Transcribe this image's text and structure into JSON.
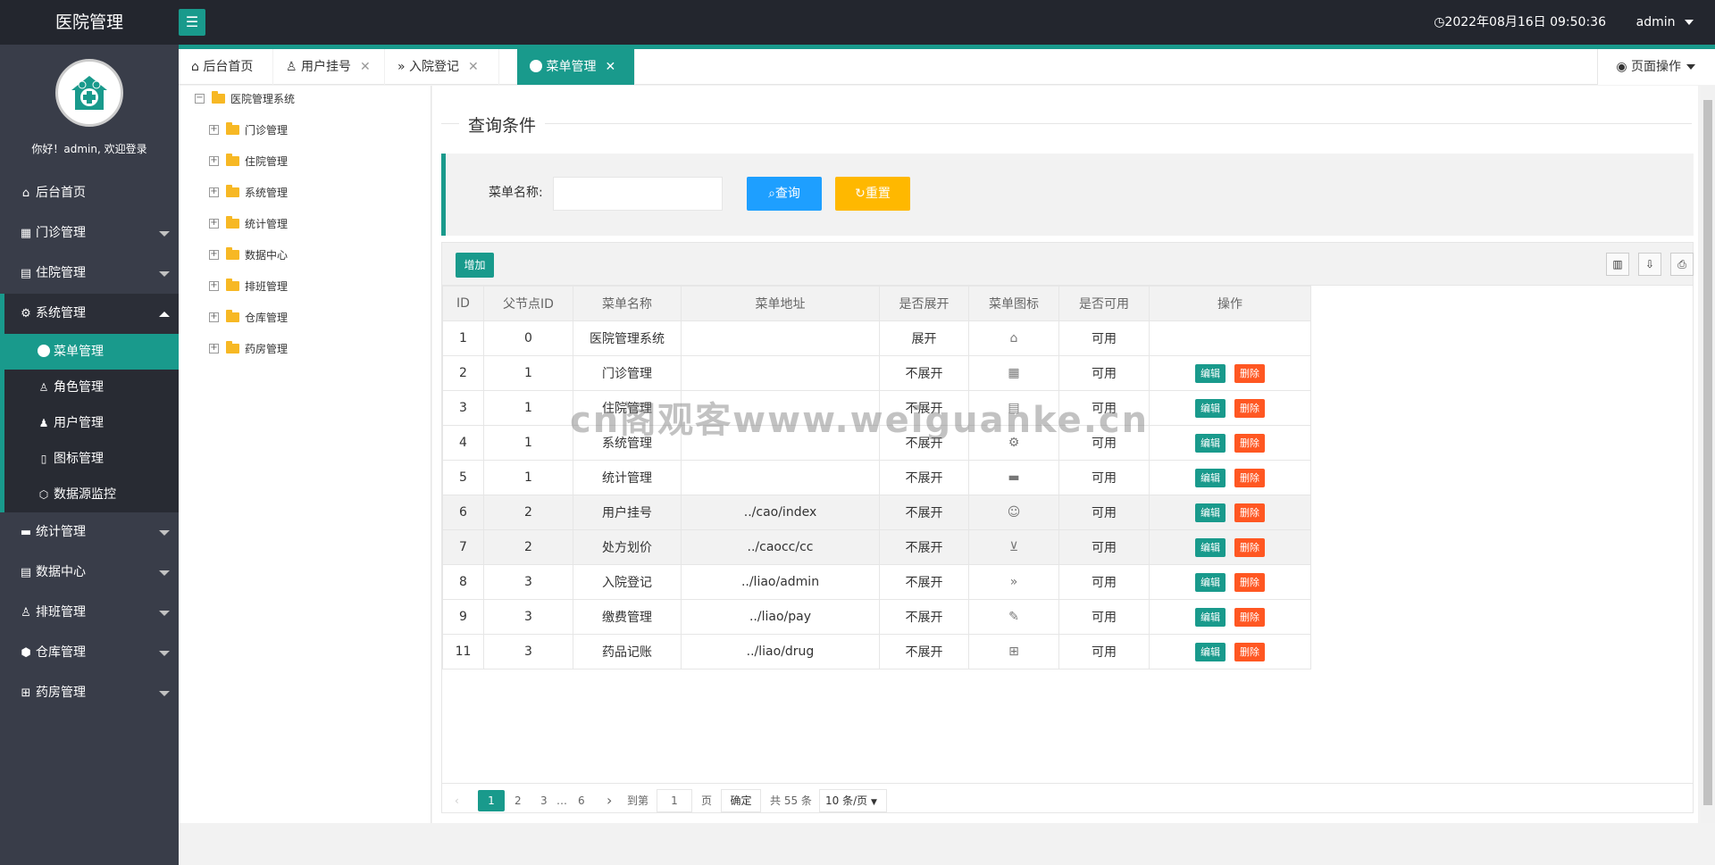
{
  "header": {
    "app_title": "医院管理",
    "datetime": "2022年08月16日 09:50:36",
    "user": "admin"
  },
  "sidebar": {
    "welcome": "你好！admin, 欢迎登录",
    "items": [
      {
        "label": "后台首页",
        "icon": "home-icon"
      },
      {
        "label": "门诊管理",
        "icon": "apps-icon"
      },
      {
        "label": "住院管理",
        "icon": "building-icon"
      },
      {
        "label": "系统管理",
        "icon": "gear-icon"
      },
      {
        "label": "统计管理",
        "icon": "chart-icon"
      },
      {
        "label": "数据中心",
        "icon": "document-icon"
      },
      {
        "label": "排班管理",
        "icon": "users-icon"
      },
      {
        "label": "仓库管理",
        "icon": "cubes-icon"
      },
      {
        "label": "药房管理",
        "icon": "book-icon"
      }
    ],
    "sub_items": [
      {
        "label": "菜单管理",
        "icon": "dot-icon"
      },
      {
        "label": "角色管理",
        "icon": "person-icon"
      },
      {
        "label": "用户管理",
        "icon": "user-icon"
      },
      {
        "label": "图标管理",
        "icon": "file-icon"
      },
      {
        "label": "数据源监控",
        "icon": "cube-icon"
      }
    ]
  },
  "tabs": [
    {
      "label": "后台首页"
    },
    {
      "label": "用户挂号"
    },
    {
      "label": "入院登记"
    },
    {
      "label": "菜单管理"
    }
  ],
  "page_op": "页面操作",
  "tree": {
    "root": "医院管理系统",
    "children": [
      "门诊管理",
      "住院管理",
      "系统管理",
      "统计管理",
      "数据中心",
      "排班管理",
      "仓库管理",
      "药房管理"
    ]
  },
  "query": {
    "legend": "查询条件",
    "menu_name_label": "菜单名称:",
    "menu_name_value": "",
    "query_btn": "查询",
    "reset_btn": "重置"
  },
  "toolbar": {
    "add_btn": "增加"
  },
  "table": {
    "columns": [
      "ID",
      "父节点ID",
      "菜单名称",
      "菜单地址",
      "是否展开",
      "菜单图标",
      "是否可用",
      "操作"
    ],
    "edit_label": "编辑",
    "delete_label": "删除",
    "rows": [
      {
        "id": "1",
        "pid": "0",
        "name": "医院管理系统",
        "url": "",
        "expand": "展开",
        "icon": "⌂",
        "enabled": "可用",
        "actions": false
      },
      {
        "id": "2",
        "pid": "1",
        "name": "门诊管理",
        "url": "",
        "expand": "不展开",
        "icon": "▦",
        "enabled": "可用",
        "actions": true
      },
      {
        "id": "3",
        "pid": "1",
        "name": "住院管理",
        "url": "",
        "expand": "不展开",
        "icon": "▤",
        "enabled": "可用",
        "actions": true
      },
      {
        "id": "4",
        "pid": "1",
        "name": "系统管理",
        "url": "",
        "expand": "不展开",
        "icon": "⚙",
        "enabled": "可用",
        "actions": true
      },
      {
        "id": "5",
        "pid": "1",
        "name": "统计管理",
        "url": "",
        "expand": "不展开",
        "icon": "▬",
        "enabled": "可用",
        "actions": true
      },
      {
        "id": "6",
        "pid": "2",
        "name": "用户挂号",
        "url": "../cao/index",
        "expand": "不展开",
        "icon": "☺",
        "enabled": "可用",
        "actions": true
      },
      {
        "id": "7",
        "pid": "2",
        "name": "处方划价",
        "url": "../caocc/cc",
        "expand": "不展开",
        "icon": "⊻",
        "enabled": "可用",
        "actions": true
      },
      {
        "id": "8",
        "pid": "3",
        "name": "入院登记",
        "url": "../liao/admin",
        "expand": "不展开",
        "icon": "»",
        "enabled": "可用",
        "actions": true
      },
      {
        "id": "9",
        "pid": "3",
        "name": "缴费管理",
        "url": "../liao/pay",
        "expand": "不展开",
        "icon": "✎",
        "enabled": "可用",
        "actions": true
      },
      {
        "id": "11",
        "pid": "3",
        "name": "药品记账",
        "url": "../liao/drug",
        "expand": "不展开",
        "icon": "⊞",
        "enabled": "可用",
        "actions": true
      }
    ]
  },
  "pager": {
    "current": "1",
    "pages": [
      "2",
      "3",
      "…",
      "6"
    ],
    "goto_label": "到第",
    "goto_value": "1",
    "page_unit": "页",
    "confirm": "确定",
    "total": "共 55 条",
    "per_page": "10 条/页"
  },
  "watermark": "cn阁观客www.weiguanke.cn",
  "colors": {
    "accent": "#199a8c",
    "header_bg": "#23262e",
    "sidebar_bg": "#393d49",
    "query_blue": "#1e9fff",
    "reset_yellow": "#ffb800",
    "delete_red": "#ff5722"
  }
}
